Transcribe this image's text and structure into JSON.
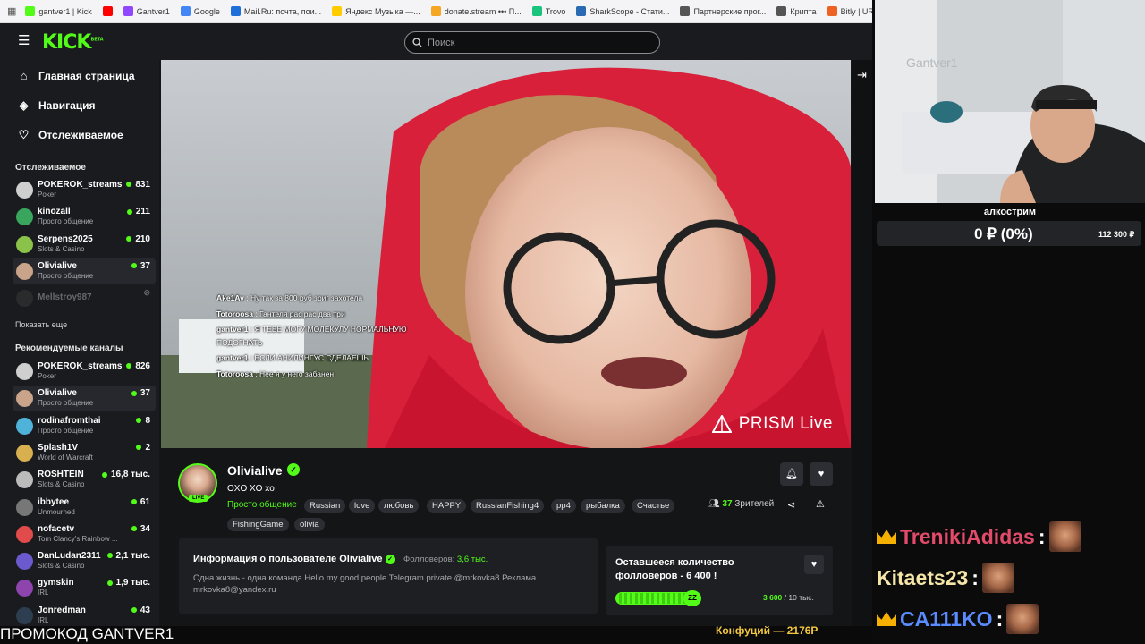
{
  "browser": {
    "bookmarks": [
      {
        "label": "gantver1 | Kick",
        "color": "#53fc18"
      },
      {
        "label": "",
        "color": "#ff0000"
      },
      {
        "label": "Gantver1",
        "color": "#9146ff"
      },
      {
        "label": "Google",
        "color": "#4285f4"
      },
      {
        "label": "Mail.Ru: почта, пои...",
        "color": "#1f6fd9"
      },
      {
        "label": "Яндекс Музыка —...",
        "color": "#ffcc00"
      },
      {
        "label": "donate.stream ••• П...",
        "color": "#f5a623"
      },
      {
        "label": "Trovo",
        "color": "#1bc47d"
      },
      {
        "label": "SharkScope - Стати...",
        "color": "#2a6ab3"
      },
      {
        "label": "Партнерские прог...",
        "color": "#555555"
      },
      {
        "label": "Крипта",
        "color": "#555555"
      },
      {
        "label": "Bitly | URL Shortene",
        "color": "#ee6123"
      }
    ]
  },
  "kick": {
    "search_placeholder": "Поиск",
    "nav": [
      {
        "label": "Главная страница",
        "icon": "home-icon"
      },
      {
        "label": "Навигация",
        "icon": "compass-icon"
      },
      {
        "label": "Отслеживаемое",
        "icon": "heart-icon"
      }
    ],
    "following_title": "Отслеживаемое",
    "following": [
      {
        "name": "POKEROK_streams",
        "category": "Poker",
        "viewers": "831",
        "color": "#cfcfcf"
      },
      {
        "name": "kinozall",
        "category": "Просто общение",
        "viewers": "211",
        "color": "#3aa55d"
      },
      {
        "name": "Serpens2025",
        "category": "Slots & Casino",
        "viewers": "210",
        "color": "#8bc34a"
      },
      {
        "name": "Olivialive",
        "category": "Просто общение",
        "viewers": "37",
        "color": "#c9a48a",
        "active": true
      },
      {
        "name": "Mellstroy987",
        "category": "",
        "viewers": "",
        "color": "#444",
        "offline": true
      }
    ],
    "show_more": "Показать еще",
    "recommended_title": "Рекомендуемые каналы",
    "recommended": [
      {
        "name": "POKEROK_streams",
        "category": "Poker",
        "viewers": "826",
        "color": "#cfcfcf"
      },
      {
        "name": "Olivialive",
        "category": "Просто общение",
        "viewers": "37",
        "color": "#c9a48a",
        "active": true
      },
      {
        "name": "rodinafromthai",
        "category": "Просто общение",
        "viewers": "8",
        "color": "#4fb3d9"
      },
      {
        "name": "Splash1V",
        "category": "World of Warcraft",
        "viewers": "2",
        "color": "#d9b04f"
      },
      {
        "name": "ROSHTEIN",
        "category": "Slots & Casino",
        "viewers": "16,8 тыс.",
        "color": "#bbbbbb"
      },
      {
        "name": "ibbytee",
        "category": "Unmourned",
        "viewers": "61",
        "color": "#777777"
      },
      {
        "name": "nofacetv",
        "category": "Tom Clancy's Rainbow ...",
        "viewers": "34",
        "color": "#e24b4b"
      },
      {
        "name": "DanLudan2311",
        "category": "Slots & Casino",
        "viewers": "2,1 тыс.",
        "color": "#6a5acd"
      },
      {
        "name": "gymskin",
        "category": "IRL",
        "viewers": "1,9 тыс.",
        "color": "#8e44ad"
      },
      {
        "name": "Jonredman",
        "category": "IRL",
        "viewers": "43",
        "color": "#2c3e50"
      }
    ],
    "video": {
      "watermark": "PRISM Live",
      "chat": [
        {
          "user": "Ake1Av",
          "text": "Ну так за 800 руб зриг захотела"
        },
        {
          "user": "Totoroosa",
          "text": "Гантеля рас рас два три"
        },
        {
          "user": "gantver1",
          "text": "Я ТЕБЕ МОГУ МОЛЕКУЛУ НОРМАЛЬНУЮ"
        },
        {
          "user": "",
          "text": "ПОДОГНАТЬ"
        },
        {
          "user": "gantver1",
          "text": "ЕСЛИ АНИЛИНГУС СДЕЛАЕШЬ"
        },
        {
          "user": "Totoroosa",
          "text": "Нее я у него забанен"
        }
      ]
    },
    "stream": {
      "live_badge": "LIVE",
      "name": "Olivialive",
      "title": "OXO XO xo",
      "category": "Просто общение",
      "tags": [
        "Russian",
        "love",
        "любовь",
        "HAPPY",
        "RussianFishing4",
        "pp4",
        "рыбалка",
        "Счастье",
        "FishingGame",
        "olivia"
      ],
      "viewers_count": "37",
      "viewers_label": "Зрителей"
    },
    "about": {
      "title": "Информация о пользователе Olivialive",
      "followers_label": "Фолловеров:",
      "followers_value": "3,6 тыс.",
      "description": "Одна жизнь - одна команда Hello my good people   Telegram private @mrkovka8 Реклама mrkovka8@yandex.ru"
    },
    "goal": {
      "title": "Оставшееся количество фолловеров - 6 400 !",
      "current": "3 600",
      "target": "/ 10 тыс.",
      "progress": 0.36
    }
  },
  "overlay": {
    "cam_title": "алкострим",
    "donation_amount": "0 ₽ (0%)",
    "donation_goal": "112 300 ₽",
    "donors": [
      {
        "name": "TrenikiAdidas",
        "color": "#e24b6a",
        "crown": true
      },
      {
        "name": "Kitaets23",
        "color": "#f5e6a8",
        "crown": false
      },
      {
        "name": "CA111KO",
        "color": "#5a8cff",
        "crown": true
      }
    ],
    "promo": "ПРОМОКОД GANTVER1",
    "ticker": "Конфуций — 2176Р"
  }
}
